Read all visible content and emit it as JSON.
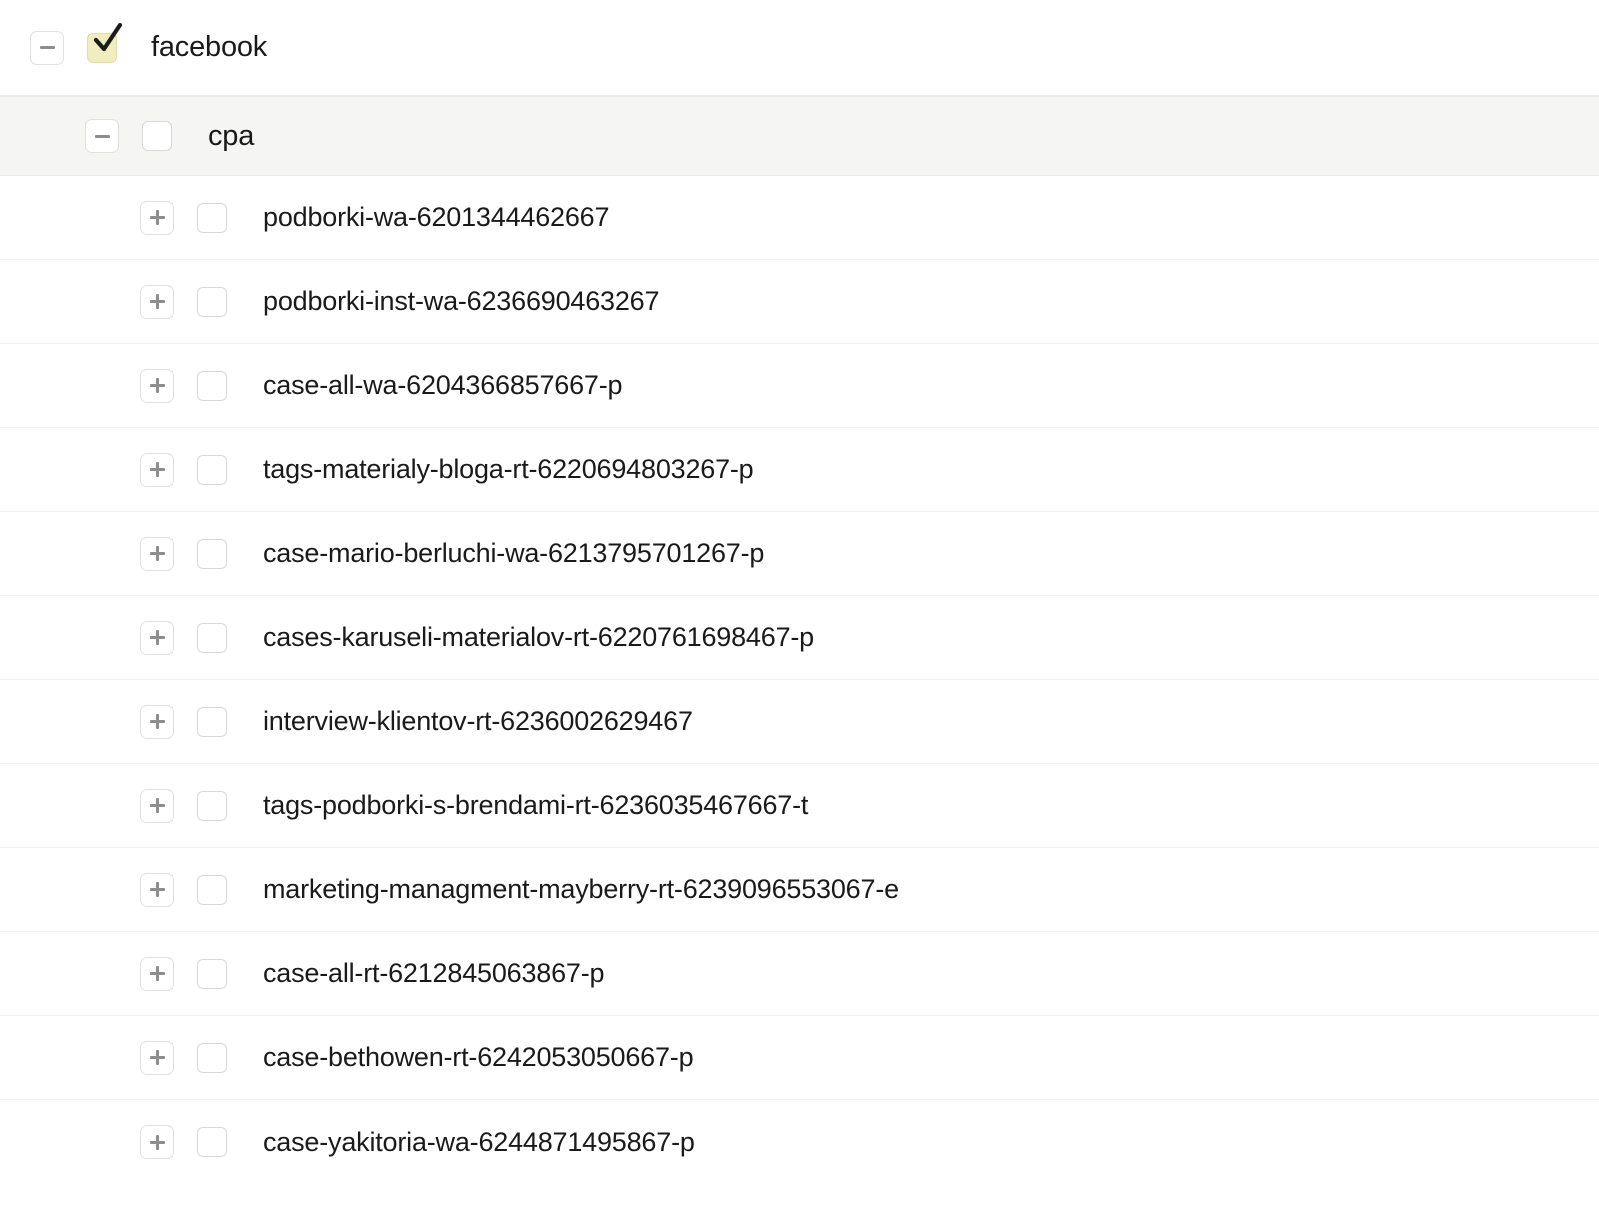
{
  "tree": {
    "nodes": [
      {
        "label": "facebook",
        "level": 0,
        "toggle": "minus-icon",
        "toggle_state": "expanded",
        "checkbox": "checkbox-checked-icon",
        "checked": true,
        "highlighted": false
      },
      {
        "label": "cpa",
        "level": 1,
        "toggle": "minus-icon",
        "toggle_state": "expanded",
        "checkbox": "checkbox-unchecked-icon",
        "checked": false,
        "highlighted": true
      },
      {
        "label": "podborki-wa-6201344462667",
        "level": 2,
        "toggle": "plus-icon",
        "toggle_state": "collapsed",
        "checkbox": "checkbox-unchecked-icon",
        "checked": false,
        "highlighted": false
      },
      {
        "label": "podborki-inst-wa-6236690463267",
        "level": 2,
        "toggle": "plus-icon",
        "toggle_state": "collapsed",
        "checkbox": "checkbox-unchecked-icon",
        "checked": false,
        "highlighted": false
      },
      {
        "label": "case-all-wa-6204366857667-p",
        "level": 2,
        "toggle": "plus-icon",
        "toggle_state": "collapsed",
        "checkbox": "checkbox-unchecked-icon",
        "checked": false,
        "highlighted": false
      },
      {
        "label": "tags-materialy-bloga-rt-6220694803267-p",
        "level": 2,
        "toggle": "plus-icon",
        "toggle_state": "collapsed",
        "checkbox": "checkbox-unchecked-icon",
        "checked": false,
        "highlighted": false
      },
      {
        "label": "case-mario-berluchi-wa-6213795701267-p",
        "level": 2,
        "toggle": "plus-icon",
        "toggle_state": "collapsed",
        "checkbox": "checkbox-unchecked-icon",
        "checked": false,
        "highlighted": false
      },
      {
        "label": "cases-karuseli-materialov-rt-6220761698467-p",
        "level": 2,
        "toggle": "plus-icon",
        "toggle_state": "collapsed",
        "checkbox": "checkbox-unchecked-icon",
        "checked": false,
        "highlighted": false
      },
      {
        "label": "interview-klientov-rt-6236002629467",
        "level": 2,
        "toggle": "plus-icon",
        "toggle_state": "collapsed",
        "checkbox": "checkbox-unchecked-icon",
        "checked": false,
        "highlighted": false
      },
      {
        "label": "tags-podborki-s-brendami-rt-6236035467667-t",
        "level": 2,
        "toggle": "plus-icon",
        "toggle_state": "collapsed",
        "checkbox": "checkbox-unchecked-icon",
        "checked": false,
        "highlighted": false
      },
      {
        "label": "marketing-managment-mayberry-rt-6239096553067-e",
        "level": 2,
        "toggle": "plus-icon",
        "toggle_state": "collapsed",
        "checkbox": "checkbox-unchecked-icon",
        "checked": false,
        "highlighted": false
      },
      {
        "label": "case-all-rt-6212845063867-p",
        "level": 2,
        "toggle": "plus-icon",
        "toggle_state": "collapsed",
        "checkbox": "checkbox-unchecked-icon",
        "checked": false,
        "highlighted": false
      },
      {
        "label": "case-bethowen-rt-6242053050667-p",
        "level": 2,
        "toggle": "plus-icon",
        "toggle_state": "collapsed",
        "checkbox": "checkbox-unchecked-icon",
        "checked": false,
        "highlighted": false
      },
      {
        "label": "case-yakitoria-wa-6244871495867-p",
        "level": 2,
        "toggle": "plus-icon",
        "toggle_state": "collapsed",
        "checkbox": "checkbox-unchecked-icon",
        "checked": false,
        "highlighted": false
      }
    ]
  },
  "colors": {
    "row_background": "#ffffff",
    "row_highlight_background": "#f5f5f3",
    "row_divider": "#efefef",
    "checkbox_checked_fill": "#f2edbe",
    "checkbox_checked_border": "#e3dca6",
    "checkbox_border": "#d8d8d8",
    "toggle_border": "#e0e0e0",
    "toggle_glyph": "#8d8d8d",
    "label_text": "#1a1a1a"
  }
}
